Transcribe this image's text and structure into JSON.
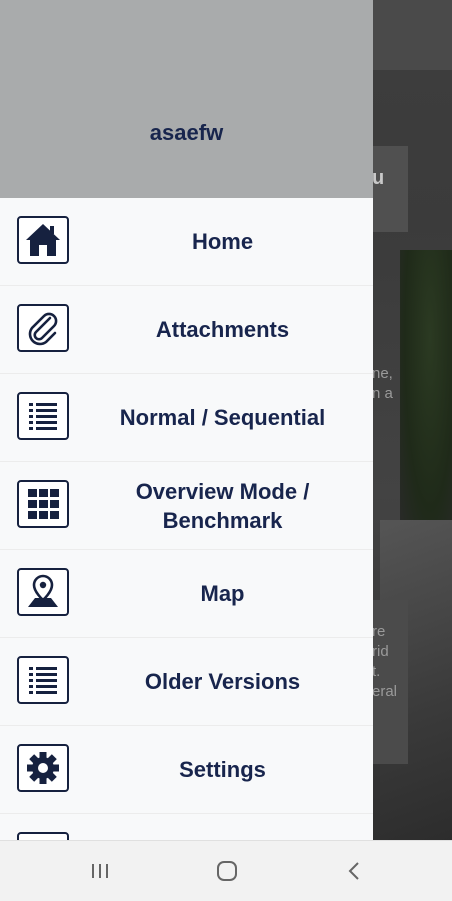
{
  "drawer": {
    "username": "asaefw",
    "items": [
      {
        "label": "Home",
        "icon": "home-icon"
      },
      {
        "label": "Attachments",
        "icon": "paperclip-icon"
      },
      {
        "label": "Normal / Sequential",
        "icon": "list-icon"
      },
      {
        "label": "Overview Mode / Benchmark",
        "icon": "grid-icon"
      },
      {
        "label": "Map",
        "icon": "map-pin-icon"
      },
      {
        "label": "Older Versions",
        "icon": "list-icon"
      },
      {
        "label": "Settings",
        "icon": "gear-icon"
      }
    ]
  },
  "background": {
    "heading_fragment": "u",
    "text_fragment_1": "ne,\nn a",
    "text_fragment_2": "re\nrid\nt.\neral"
  },
  "navbar": {
    "recents_icon": "recents-icon",
    "home_icon": "home-circle-icon",
    "back_icon": "back-chevron-icon"
  },
  "colors": {
    "drawer_header": "#a9abac",
    "drawer_bg": "#f8f9fa",
    "text": "#18254d",
    "icon": "#16213f"
  }
}
